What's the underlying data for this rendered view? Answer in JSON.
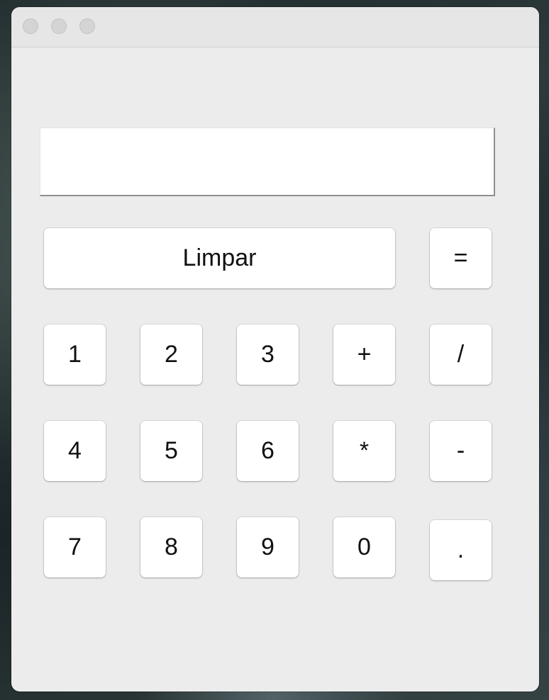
{
  "window": {
    "traffic_lights": [
      "close",
      "minimize",
      "maximize"
    ]
  },
  "display": {
    "value": ""
  },
  "buttons": {
    "clear": "Limpar",
    "equals": "=",
    "row1": [
      "1",
      "2",
      "3",
      "+",
      "/"
    ],
    "row2": [
      "4",
      "5",
      "6",
      "*",
      "-"
    ],
    "row3": [
      "7",
      "8",
      "9",
      "0",
      "."
    ]
  },
  "colors": {
    "window_bg": "#ececec",
    "button_bg": "#ffffff",
    "titlebar_bg": "#e6e6e6"
  }
}
